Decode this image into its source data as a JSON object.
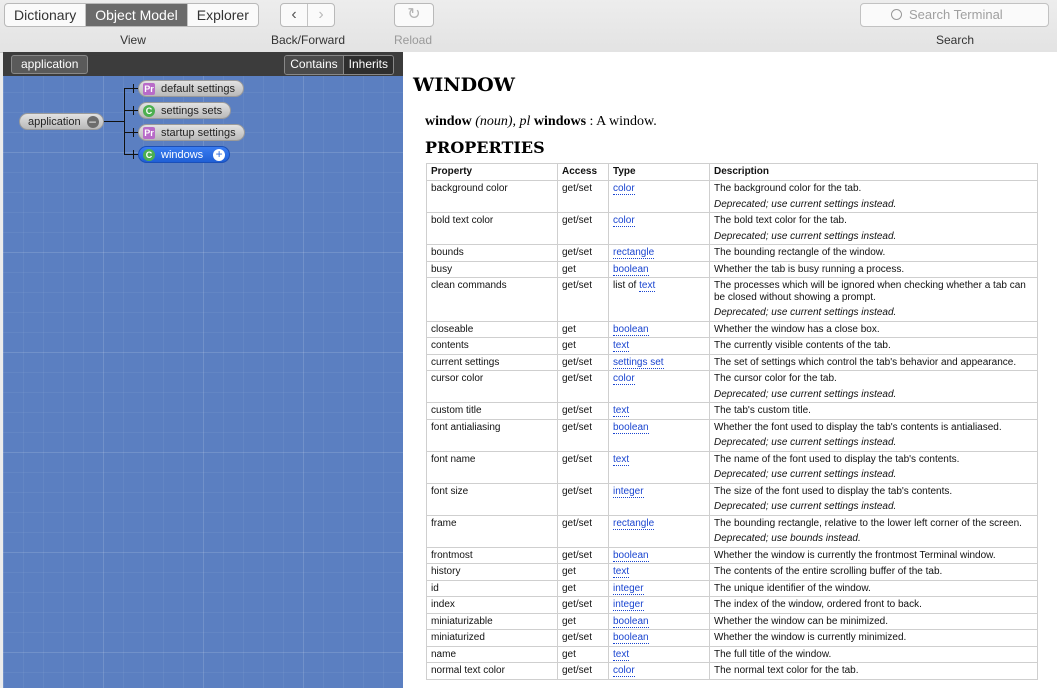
{
  "toolbar": {
    "view_tabs": [
      "Dictionary",
      "Object Model",
      "Explorer"
    ],
    "view_label": "View",
    "back_forward_label": "Back/Forward",
    "reload_label": "Reload",
    "search_placeholder": "Search Terminal",
    "search_label": "Search"
  },
  "left": {
    "crumb": "application",
    "relation_tabs": [
      "Contains",
      "Inherits"
    ],
    "root_node": "application",
    "children": [
      {
        "label": "default settings",
        "kind": "Pr"
      },
      {
        "label": "settings sets",
        "kind": "C"
      },
      {
        "label": "startup settings",
        "kind": "Pr"
      },
      {
        "label": "windows",
        "kind": "C"
      }
    ]
  },
  "right": {
    "title": "WINDOW",
    "def_term": "window",
    "def_pos": "(noun), pl",
    "def_plural": "windows",
    "def_text": ": A window.",
    "properties_heading": "PROPERTIES",
    "columns": [
      "Property",
      "Access",
      "Type",
      "Description"
    ],
    "rows": [
      {
        "p": "background color",
        "a": "get/set",
        "t": "color",
        "d": "The background color for the tab.",
        "dep": "Deprecated; use current settings instead."
      },
      {
        "p": "bold text color",
        "a": "get/set",
        "t": "color",
        "d": "The bold text color for the tab.",
        "dep": "Deprecated; use current settings instead."
      },
      {
        "p": "bounds",
        "a": "get/set",
        "t": "rectangle",
        "d": "The bounding rectangle of the window."
      },
      {
        "p": "busy",
        "a": "get",
        "t": "boolean",
        "d": "Whether the tab is busy running a process."
      },
      {
        "p": "clean commands",
        "a": "get/set",
        "tpre": "list of ",
        "t": "text",
        "d": "The processes which will be ignored when checking whether a tab can be closed without showing a prompt.",
        "dep": "Deprecated; use current settings instead."
      },
      {
        "p": "closeable",
        "a": "get",
        "t": "boolean",
        "d": "Whether the window has a close box."
      },
      {
        "p": "contents",
        "a": "get",
        "t": "text",
        "d": "The currently visible contents of the tab."
      },
      {
        "p": "current settings",
        "a": "get/set",
        "t": "settings set",
        "d": "The set of settings which control the tab's behavior and appearance."
      },
      {
        "p": "cursor color",
        "a": "get/set",
        "t": "color",
        "d": "The cursor color for the tab.",
        "dep": "Deprecated; use current settings instead."
      },
      {
        "p": "custom title",
        "a": "get/set",
        "t": "text",
        "d": "The tab's custom title."
      },
      {
        "p": "font antialiasing",
        "a": "get/set",
        "t": "boolean",
        "d": "Whether the font used to display the tab's contents is antialiased.",
        "dep": "Deprecated; use current settings instead."
      },
      {
        "p": "font name",
        "a": "get/set",
        "t": "text",
        "d": "The name of the font used to display the tab's contents.",
        "dep": "Deprecated; use current settings instead."
      },
      {
        "p": "font size",
        "a": "get/set",
        "t": "integer",
        "d": "The size of the font used to display the tab's contents.",
        "dep": "Deprecated; use current settings instead."
      },
      {
        "p": "frame",
        "a": "get/set",
        "t": "rectangle",
        "d": "The bounding rectangle, relative to the lower left corner of the screen.",
        "dep": "Deprecated; use bounds instead."
      },
      {
        "p": "frontmost",
        "a": "get/set",
        "t": "boolean",
        "d": "Whether the window is currently the frontmost Terminal window."
      },
      {
        "p": "history",
        "a": "get",
        "t": "text",
        "d": "The contents of the entire scrolling buffer of the tab."
      },
      {
        "p": "id",
        "a": "get",
        "t": "integer",
        "d": "The unique identifier of the window."
      },
      {
        "p": "index",
        "a": "get/set",
        "t": "integer",
        "d": "The index of the window, ordered front to back."
      },
      {
        "p": "miniaturizable",
        "a": "get",
        "t": "boolean",
        "d": "Whether the window can be minimized."
      },
      {
        "p": "miniaturized",
        "a": "get/set",
        "t": "boolean",
        "d": "Whether the window is currently minimized."
      },
      {
        "p": "name",
        "a": "get",
        "t": "text",
        "d": "The full title of the window."
      },
      {
        "p": "normal text color",
        "a": "get/set",
        "t": "color",
        "d": "The normal text color for the tab."
      }
    ]
  }
}
